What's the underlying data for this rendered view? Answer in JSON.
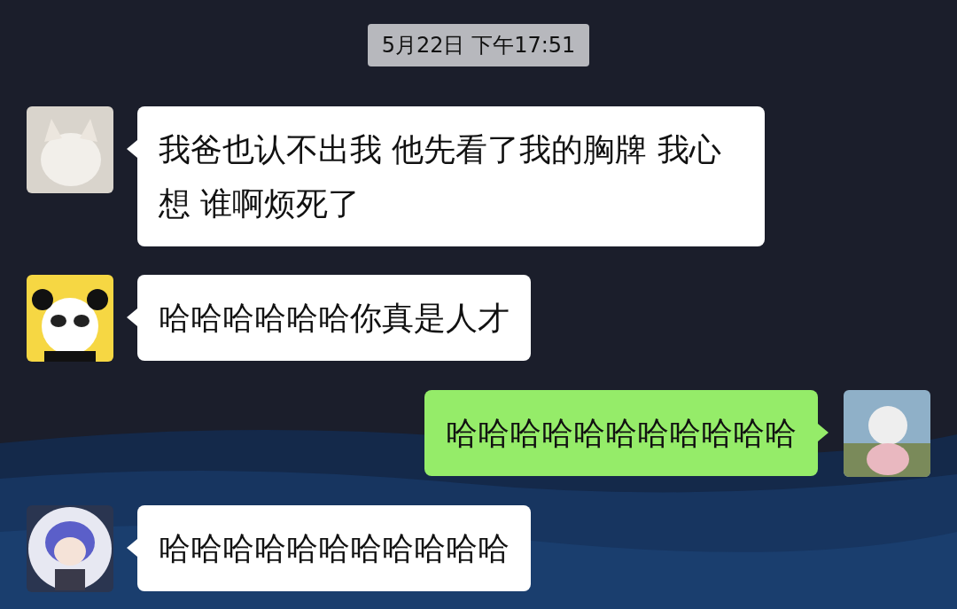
{
  "timestamp": "5月22日 下午17:51",
  "messages": [
    {
      "kind": "received",
      "text": "我爸也认不出我 他先看了我的胸牌 我心想 谁啊烦死了"
    },
    {
      "kind": "received",
      "text": "哈哈哈哈哈哈你真是人才"
    },
    {
      "kind": "sent",
      "text": "哈哈哈哈哈哈哈哈哈哈哈"
    },
    {
      "kind": "received",
      "text": "哈哈哈哈哈哈哈哈哈哈哈"
    }
  ]
}
